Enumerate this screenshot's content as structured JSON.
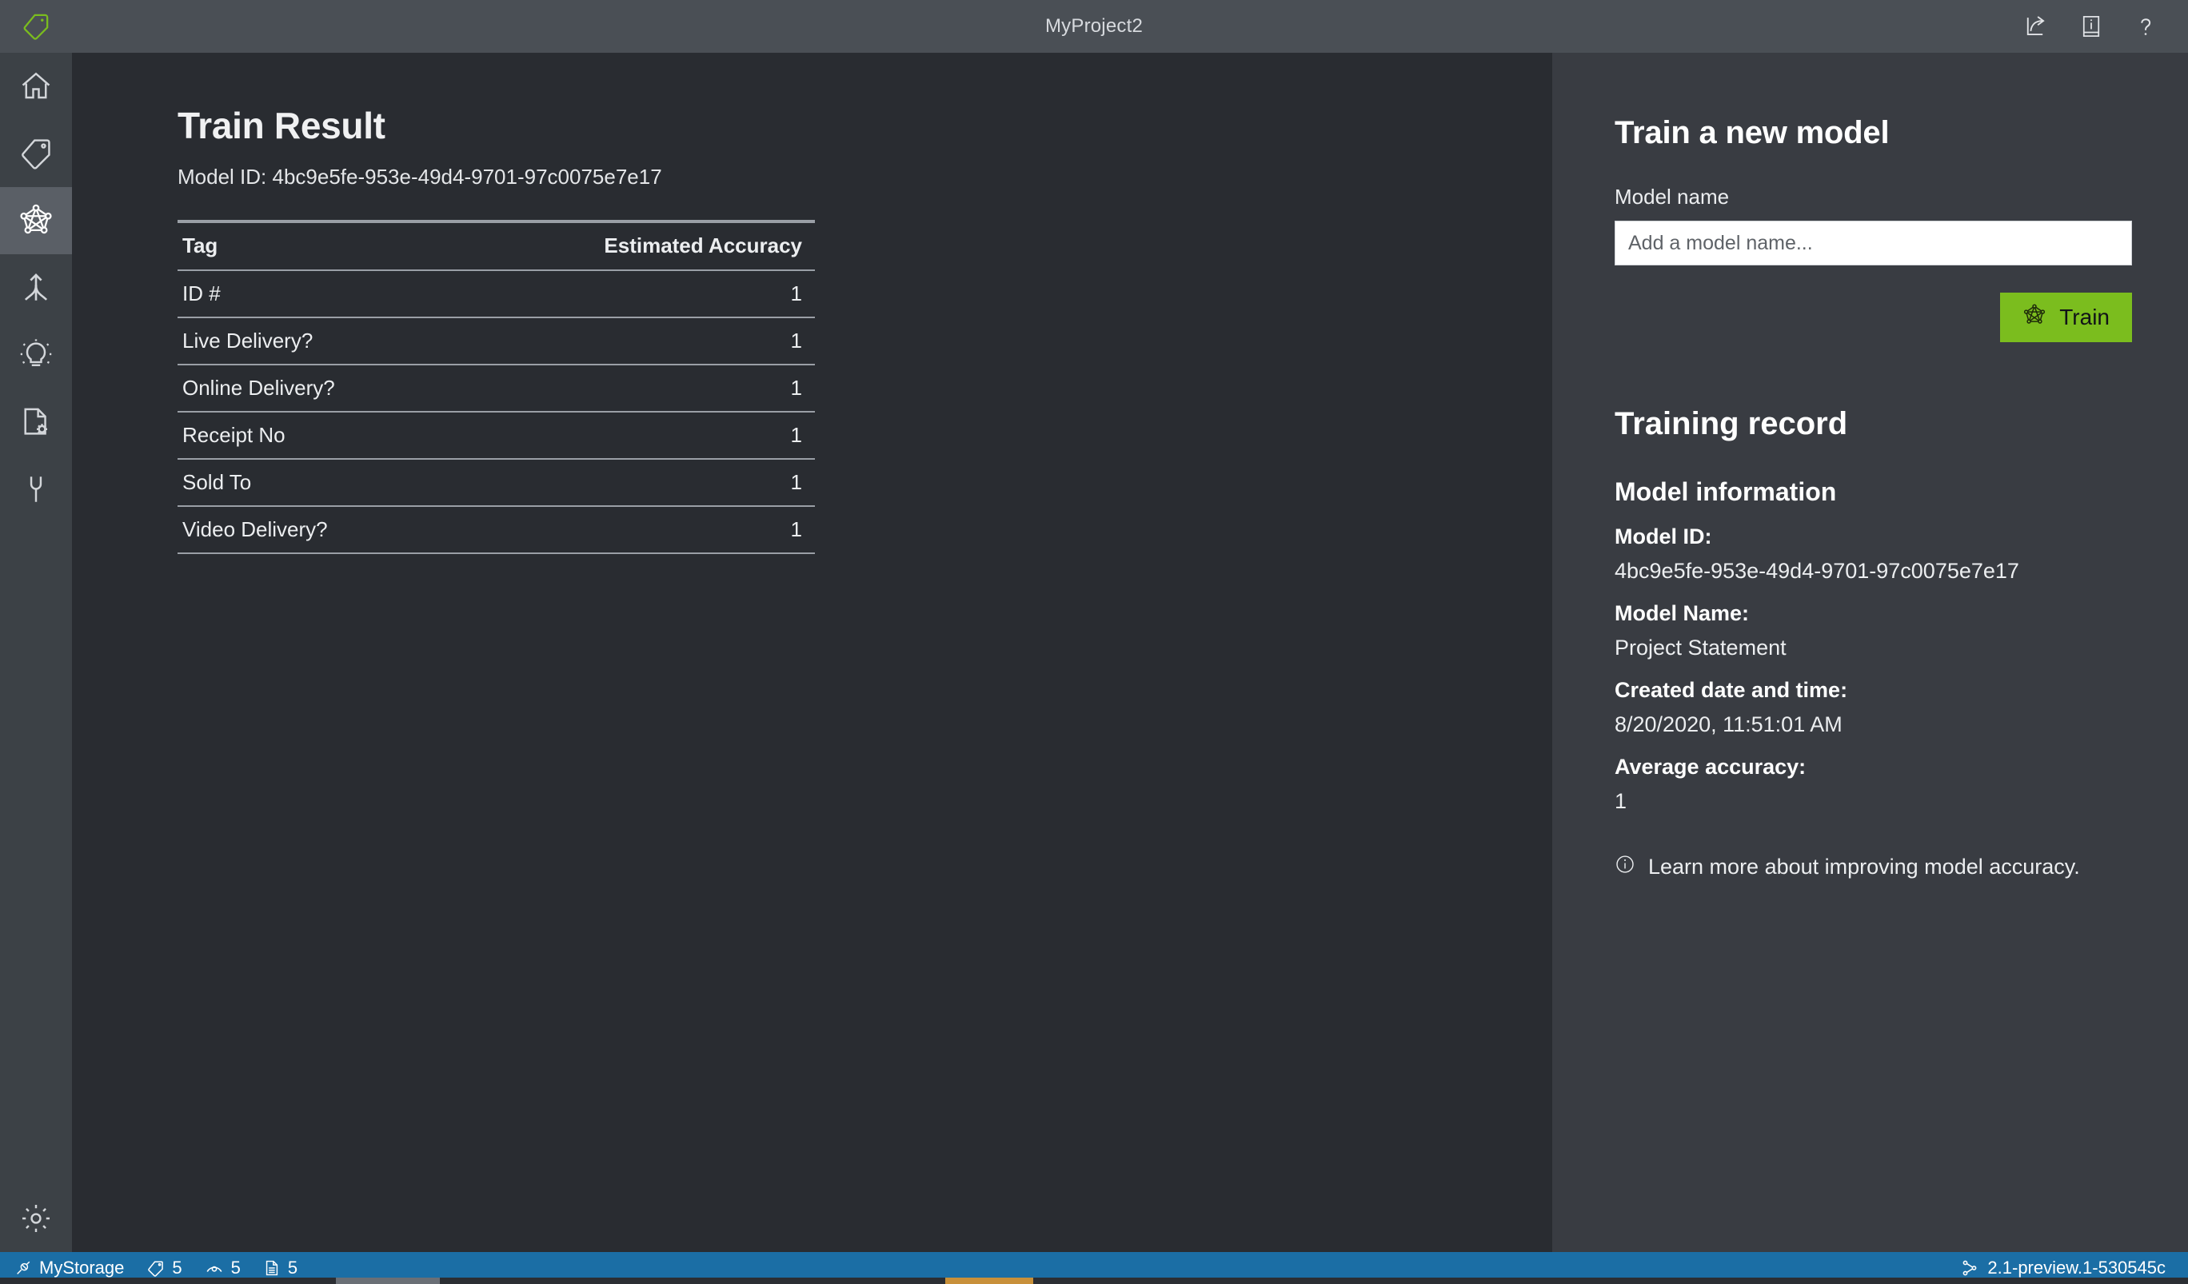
{
  "titlebar": {
    "title": "MyProject2",
    "logo_icon": "tag-icon",
    "actions": [
      {
        "name": "share-icon",
        "label": "Share"
      },
      {
        "name": "info-book-icon",
        "label": "Documentation"
      },
      {
        "name": "help-icon",
        "label": "Help"
      }
    ]
  },
  "sidebar": {
    "items": [
      {
        "icon": "home-icon",
        "label": "Home",
        "active": false
      },
      {
        "icon": "tag-icon",
        "label": "Tag editor",
        "active": false
      },
      {
        "icon": "model-graph-icon",
        "label": "Train",
        "active": true
      },
      {
        "icon": "merge-branch-icon",
        "label": "Compose",
        "active": false
      },
      {
        "icon": "lightbulb-icon",
        "label": "Predict",
        "active": false
      },
      {
        "icon": "document-gear-icon",
        "label": "Model compose",
        "active": false
      },
      {
        "icon": "plug-icon",
        "label": "Connections",
        "active": false
      }
    ],
    "footer": {
      "icon": "gear-icon",
      "label": "Settings"
    }
  },
  "main": {
    "page_title": "Train Result",
    "model_id_line": "Model ID: 4bc9e5fe-953e-49d4-9701-97c0075e7e17",
    "table": {
      "columns": [
        "Tag",
        "Estimated Accuracy"
      ],
      "rows": [
        {
          "tag": "ID #",
          "accuracy": "1"
        },
        {
          "tag": "Live Delivery?",
          "accuracy": "1"
        },
        {
          "tag": "Online Delivery?",
          "accuracy": "1"
        },
        {
          "tag": "Receipt No",
          "accuracy": "1"
        },
        {
          "tag": "Sold To",
          "accuracy": "1"
        },
        {
          "tag": "Video Delivery?",
          "accuracy": "1"
        }
      ]
    }
  },
  "right_panel": {
    "heading": "Train a new model",
    "model_name_label": "Model name",
    "model_name_value": "",
    "model_name_placeholder": "Add a model name...",
    "train_button_label": "Train",
    "train_button_icon": "model-graph-icon",
    "train_button_color": "#7bbd1e",
    "training_record_heading": "Training record",
    "model_information_heading": "Model information",
    "fields": [
      {
        "key": "Model ID:",
        "value": "4bc9e5fe-953e-49d4-9701-97c0075e7e17"
      },
      {
        "key": "Model Name:",
        "value": "Project Statement"
      },
      {
        "key": "Created date and time:",
        "value": "8/20/2020, 11:51:01 AM"
      },
      {
        "key": "Average accuracy:",
        "value": "1"
      }
    ],
    "note": {
      "icon": "info-circle-icon",
      "text": "Learn more about improving model accuracy."
    }
  },
  "statusbar": {
    "background": "#1b6ea5",
    "connection_icon": "plug-icon",
    "connection_label": "MyStorage",
    "counters": [
      {
        "icon": "tag-icon",
        "value": "5"
      },
      {
        "icon": "eye-icon",
        "value": "5"
      },
      {
        "icon": "document-icon",
        "value": "5"
      }
    ],
    "version_icon": "branch-icon",
    "version": "2.1-preview.1-530545c"
  }
}
